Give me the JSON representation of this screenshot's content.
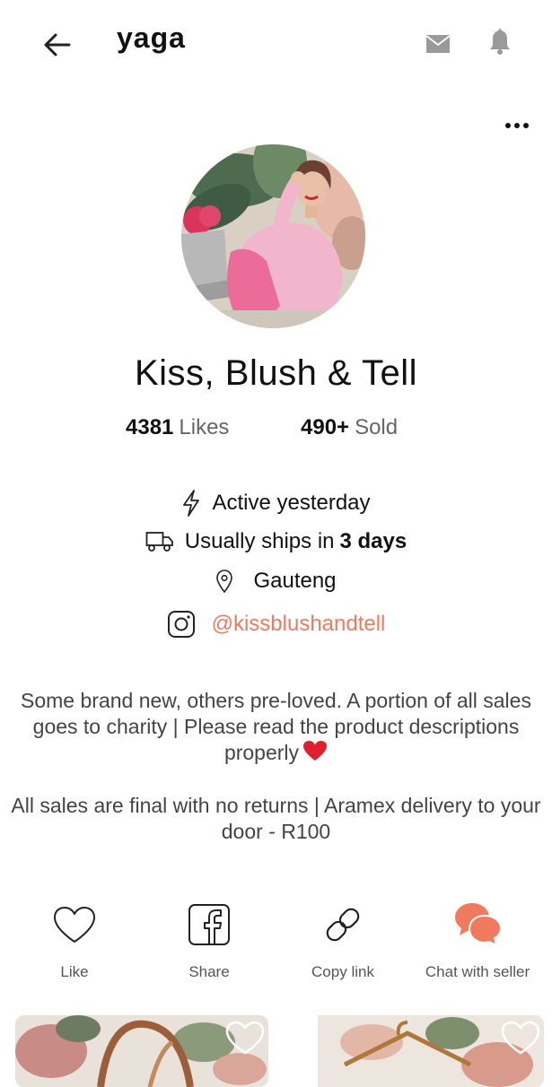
{
  "header": {
    "logo": "yaga",
    "back_icon": "arrow-left-icon",
    "mail_icon": "envelope-icon",
    "bell_icon": "bell-icon",
    "more_icon": "more-dots-icon"
  },
  "profile": {
    "name": "Kiss, Blush & Tell",
    "likes_count": "4381",
    "likes_label": "Likes",
    "sold_count": "490+",
    "sold_label": "Sold",
    "active": "Active yesterday",
    "ships_prefix": "Usually ships in",
    "ships_days": "3 days",
    "location": "Gauteng",
    "instagram": "@kissblushandtell"
  },
  "bio": {
    "line1": "Some brand new, others pre-loved. A portion of all sales goes to charity | Please read the product descriptions properly",
    "line2": "All sales are final with no returns | Aramex delivery to your door - R100"
  },
  "actions": {
    "like": "Like",
    "share": "Share",
    "copy_link": "Copy link",
    "chat": "Chat with seller"
  },
  "colors": {
    "accent": "#f07a5e",
    "text": "#111111",
    "muted": "#666666"
  }
}
